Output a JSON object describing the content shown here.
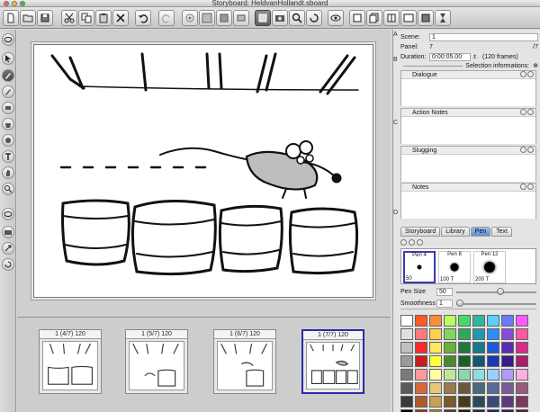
{
  "window": {
    "title": "Storyboard: HeldvanHollandt.sboard"
  },
  "scene_info": {
    "scene_label": "Scene:",
    "scene_value": "1",
    "panel_label": "Panel:",
    "panel_value": "7",
    "panel_total": "/7",
    "duration_label": "Duration:",
    "duration_value": "0:00:05.00",
    "duration_frames": "(120 frames)"
  },
  "selection_info": {
    "title": "Selection informations:",
    "boxes": [
      "Dialogue",
      "Action Notes",
      "Slugging",
      "Notes"
    ]
  },
  "tabs": [
    {
      "label": "Storyboard",
      "active": false
    },
    {
      "label": "Library",
      "active": false
    },
    {
      "label": "Pen",
      "active": true
    },
    {
      "label": "Text",
      "active": false
    }
  ],
  "brushes": [
    {
      "name": "Pen 4",
      "size": "50",
      "selected": true
    },
    {
      "name": "Pen 8",
      "size": "100 T",
      "selected": false
    },
    {
      "name": "Pen 12",
      "size": "200 T",
      "selected": false
    }
  ],
  "pen_size": {
    "label": "Pen Size",
    "value": "50",
    "fraction": 0.55
  },
  "smoothness": {
    "label": "Smoothness",
    "value": "1",
    "fraction": 0.05
  },
  "palette": [
    "#ffffff",
    "#ff5a1f",
    "#ff8a3a",
    "#b8ff5e",
    "#4ad86b",
    "#2fb8a0",
    "#5ad0ff",
    "#6a7aff",
    "#ff5aff",
    "#e0e0e0",
    "#ff7a7a",
    "#ffd04a",
    "#7cd95a",
    "#2ea85a",
    "#1e9ab0",
    "#2e8cff",
    "#8a4ad8",
    "#ff5aa0",
    "#c0c0c0",
    "#ff2a2a",
    "#ffe85a",
    "#6ab03a",
    "#1e7a3a",
    "#157a90",
    "#1e5ad8",
    "#5a2ab0",
    "#d82a8a",
    "#9a9a9a",
    "#c81e1e",
    "#ffff3a",
    "#4a8a2a",
    "#16602a",
    "#0e5a70",
    "#1a3ab0",
    "#3a1a8a",
    "#a81e6a",
    "#7a7a7a",
    "#ff9a9a",
    "#ffffa0",
    "#bce89a",
    "#8ad8aa",
    "#8ae0e0",
    "#9ad0ff",
    "#b09aff",
    "#ffb0e0",
    "#5a5a5a",
    "#d86a3a",
    "#e8c87a",
    "#9a7a4a",
    "#6a5a3a",
    "#4a6a7a",
    "#5a6a9a",
    "#7a5a9a",
    "#9a5a7a",
    "#3a3a3a",
    "#b05a2a",
    "#c8a050",
    "#7a5a2a",
    "#4a3a1a",
    "#2a4a5a",
    "#3a4a7a",
    "#5a3a7a",
    "#7a3a5a",
    "#000000",
    "#8a3a1a",
    "#a07a30",
    "#5a3a10",
    "#2a1a0a",
    "#1a2a3a",
    "#1a2a5a",
    "#3a1a5a",
    "#5a1a3a"
  ],
  "filmstrip": [
    {
      "label": "1 (4/7) 120",
      "selected": false
    },
    {
      "label": "1 (5/7) 120",
      "selected": false
    },
    {
      "label": "1 (6/7) 120",
      "selected": false
    },
    {
      "label": "1 (7/7) 120",
      "selected": true
    }
  ],
  "side_letters": [
    "A",
    "B",
    "C",
    "D"
  ]
}
